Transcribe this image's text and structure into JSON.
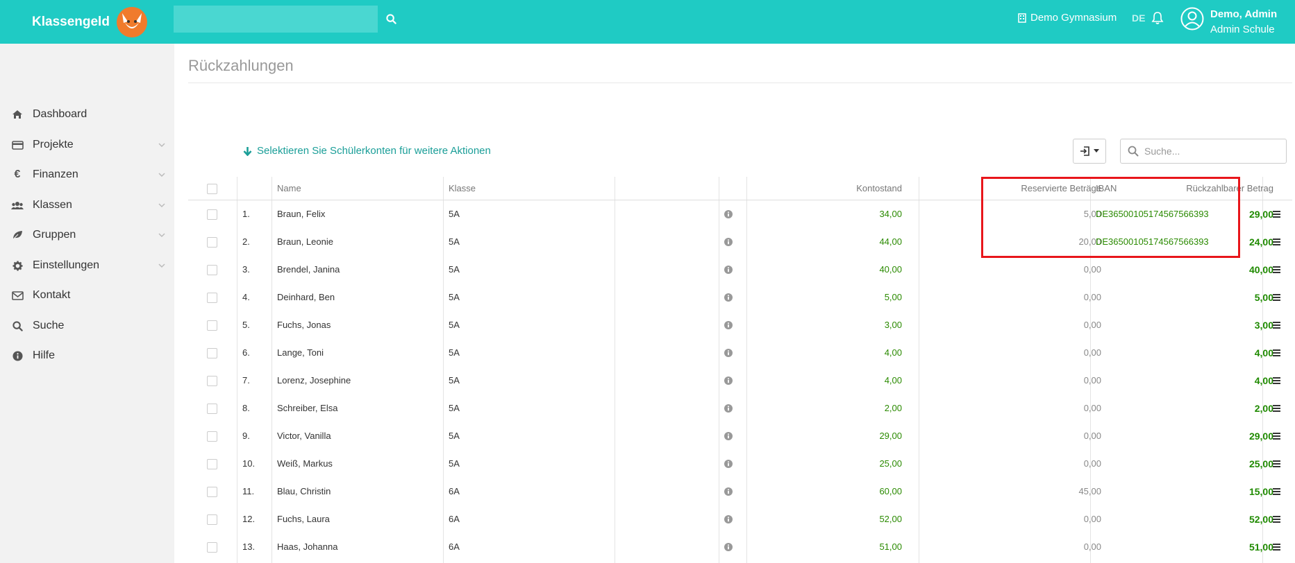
{
  "header": {
    "brand": "Klassengeld",
    "school": "Demo Gymnasium",
    "lang": "DE",
    "user_name": "Demo, Admin",
    "user_role": "Admin Schule",
    "brand_color": "#1fcbc4"
  },
  "sidebar": {
    "items": [
      {
        "label": "Dashboard",
        "icon": "home-icon",
        "chevron": false
      },
      {
        "label": "Projekte",
        "icon": "credit-card-icon",
        "chevron": true
      },
      {
        "label": "Finanzen",
        "icon": "euro-icon",
        "chevron": true
      },
      {
        "label": "Klassen",
        "icon": "users-icon",
        "chevron": true
      },
      {
        "label": "Gruppen",
        "icon": "leaf-icon",
        "chevron": true
      },
      {
        "label": "Einstellungen",
        "icon": "gear-icon",
        "chevron": true
      },
      {
        "label": "Kontakt",
        "icon": "envelope-icon",
        "chevron": false
      },
      {
        "label": "Suche",
        "icon": "search-icon",
        "chevron": false
      },
      {
        "label": "Hilfe",
        "icon": "info-icon",
        "chevron": false
      }
    ]
  },
  "main": {
    "title": "Rückzahlungen",
    "hint": "Selektieren Sie Schülerkonten für weitere Aktionen",
    "search_placeholder": "Suche..."
  },
  "table": {
    "columns": {
      "name": "Name",
      "klasse": "Klasse",
      "kontostand": "Kontostand",
      "reserviert": "Reservierte Beträge",
      "rueckzahlbar": "Rückzahlbarer Betrag",
      "iban": "IBAN"
    },
    "rows": [
      {
        "nr": "1.",
        "name": "Braun, Felix",
        "klasse": "5A",
        "kontostand": "34,00",
        "reserviert": "5,00",
        "rueckzahlbar": "29,00",
        "iban": "DE36500105174567566393"
      },
      {
        "nr": "2.",
        "name": "Braun, Leonie",
        "klasse": "5A",
        "kontostand": "44,00",
        "reserviert": "20,00",
        "rueckzahlbar": "24,00",
        "iban": "DE36500105174567566393"
      },
      {
        "nr": "3.",
        "name": "Brendel, Janina",
        "klasse": "5A",
        "kontostand": "40,00",
        "reserviert": "0,00",
        "rueckzahlbar": "40,00",
        "iban": ""
      },
      {
        "nr": "4.",
        "name": "Deinhard, Ben",
        "klasse": "5A",
        "kontostand": "5,00",
        "reserviert": "0,00",
        "rueckzahlbar": "5,00",
        "iban": ""
      },
      {
        "nr": "5.",
        "name": "Fuchs, Jonas",
        "klasse": "5A",
        "kontostand": "3,00",
        "reserviert": "0,00",
        "rueckzahlbar": "3,00",
        "iban": ""
      },
      {
        "nr": "6.",
        "name": "Lange, Toni",
        "klasse": "5A",
        "kontostand": "4,00",
        "reserviert": "0,00",
        "rueckzahlbar": "4,00",
        "iban": ""
      },
      {
        "nr": "7.",
        "name": "Lorenz, Josephine",
        "klasse": "5A",
        "kontostand": "4,00",
        "reserviert": "0,00",
        "rueckzahlbar": "4,00",
        "iban": ""
      },
      {
        "nr": "8.",
        "name": "Schreiber, Elsa",
        "klasse": "5A",
        "kontostand": "2,00",
        "reserviert": "0,00",
        "rueckzahlbar": "2,00",
        "iban": ""
      },
      {
        "nr": "9.",
        "name": "Victor, Vanilla",
        "klasse": "5A",
        "kontostand": "29,00",
        "reserviert": "0,00",
        "rueckzahlbar": "29,00",
        "iban": ""
      },
      {
        "nr": "10.",
        "name": "Weiß, Markus",
        "klasse": "5A",
        "kontostand": "25,00",
        "reserviert": "0,00",
        "rueckzahlbar": "25,00",
        "iban": ""
      },
      {
        "nr": "11.",
        "name": "Blau, Christin",
        "klasse": "6A",
        "kontostand": "60,00",
        "reserviert": "45,00",
        "rueckzahlbar": "15,00",
        "iban": ""
      },
      {
        "nr": "12.",
        "name": "Fuchs, Laura",
        "klasse": "6A",
        "kontostand": "52,00",
        "reserviert": "0,00",
        "rueckzahlbar": "52,00",
        "iban": ""
      },
      {
        "nr": "13.",
        "name": "Haas, Johanna",
        "klasse": "6A",
        "kontostand": "51,00",
        "reserviert": "0,00",
        "rueckzahlbar": "51,00",
        "iban": ""
      }
    ]
  }
}
